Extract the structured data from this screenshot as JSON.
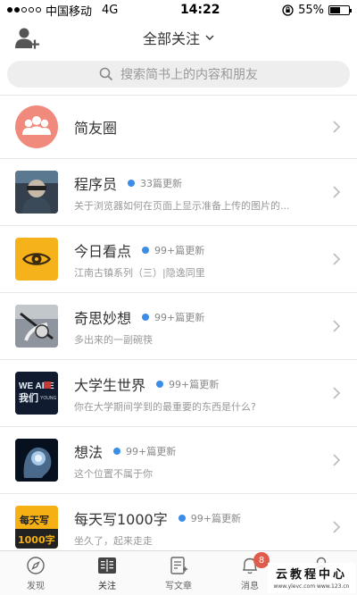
{
  "status_bar": {
    "carrier": "中国移动",
    "network": "4G",
    "time": "14:22",
    "battery": "55%",
    "battery_level": 0.55
  },
  "header": {
    "title": "全部关注"
  },
  "search": {
    "placeholder": "搜索简书上的内容和朋友"
  },
  "circle_row": {
    "title": "简友圈"
  },
  "items": [
    {
      "title": "程序员",
      "badge": "33篇更新",
      "subtitle": "关于浏览器如何在页面上显示准备上传的图片的..."
    },
    {
      "title": "今日看点",
      "badge": "99+篇更新",
      "subtitle": "江南古镇系列（三）|隐逸同里"
    },
    {
      "title": "奇思妙想",
      "badge": "99+篇更新",
      "subtitle": "多出来的一副碗筷"
    },
    {
      "title": "大学生世界",
      "badge": "99+篇更新",
      "subtitle": "你在大学期间学到的最重要的东西是什么?"
    },
    {
      "title": "想法",
      "badge": "99+篇更新",
      "subtitle": "这个位置不属于你"
    },
    {
      "title": "每天写1000字",
      "badge": "99+篇更新",
      "subtitle": "坐久了，起来走走"
    }
  ],
  "thumb_text": {
    "weare": "WE ARE",
    "women": "我们",
    "young": "YOUNG",
    "meitianxie": "每天写",
    "qianzi": "1000字"
  },
  "tabs": [
    {
      "label": "发现"
    },
    {
      "label": "关注"
    },
    {
      "label": "写文章"
    },
    {
      "label": "消息",
      "count": "8"
    },
    {
      "label": "我的"
    }
  ],
  "watermark": {
    "main": "云教程中心",
    "sub": "www.ylevc.com  www.123.cn"
  },
  "colors": {
    "accent": "#3b8de8",
    "badge": "#e05b4b",
    "circle": "#f08a7c"
  }
}
